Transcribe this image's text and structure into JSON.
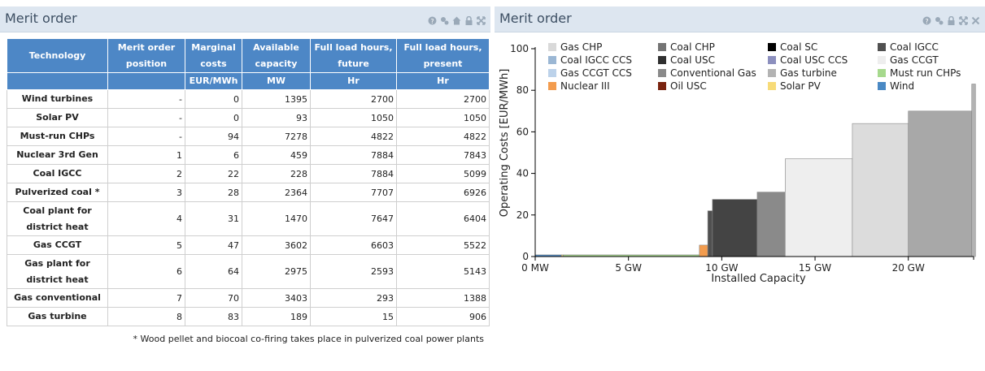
{
  "left_panel": {
    "title": "Merit order",
    "table": {
      "headers": [
        "Technology",
        "Merit order position",
        "Marginal costs",
        "Available capacity",
        "Full load hours, future",
        "Full load hours, present"
      ],
      "units": [
        "",
        "",
        "EUR/MWh",
        "MW",
        "Hr",
        "Hr"
      ],
      "rows": [
        {
          "technology": "Wind turbines",
          "position": "-",
          "marginal_costs": "0",
          "capacity": "1395",
          "flh_future": "2700",
          "flh_present": "2700"
        },
        {
          "technology": "Solar PV",
          "position": "-",
          "marginal_costs": "0",
          "capacity": "93",
          "flh_future": "1050",
          "flh_present": "1050"
        },
        {
          "technology": "Must-run CHPs",
          "position": "-",
          "marginal_costs": "94",
          "capacity": "7278",
          "flh_future": "4822",
          "flh_present": "4822"
        },
        {
          "technology": "Nuclear 3rd Gen",
          "position": "1",
          "marginal_costs": "6",
          "capacity": "459",
          "flh_future": "7884",
          "flh_present": "7843"
        },
        {
          "technology": "Coal IGCC",
          "position": "2",
          "marginal_costs": "22",
          "capacity": "228",
          "flh_future": "7884",
          "flh_present": "5099"
        },
        {
          "technology": "Pulverized coal *",
          "position": "3",
          "marginal_costs": "28",
          "capacity": "2364",
          "flh_future": "7707",
          "flh_present": "6926"
        },
        {
          "technology": "Coal plant for district heat",
          "position": "4",
          "marginal_costs": "31",
          "capacity": "1470",
          "flh_future": "7647",
          "flh_present": "6404"
        },
        {
          "technology": "Gas CCGT",
          "position": "5",
          "marginal_costs": "47",
          "capacity": "3602",
          "flh_future": "6603",
          "flh_present": "5522"
        },
        {
          "technology": "Gas plant for district heat",
          "position": "6",
          "marginal_costs": "64",
          "capacity": "2975",
          "flh_future": "2593",
          "flh_present": "5143"
        },
        {
          "technology": "Gas conventional",
          "position": "7",
          "marginal_costs": "70",
          "capacity": "3403",
          "flh_future": "293",
          "flh_present": "1388"
        },
        {
          "technology": "Gas turbine",
          "position": "8",
          "marginal_costs": "83",
          "capacity": "189",
          "flh_future": "15",
          "flh_present": "906"
        }
      ],
      "footnote": "* Wood pellet and biocoal co-firing takes place in pulverized coal power plants"
    }
  },
  "right_panel": {
    "title": "Merit order"
  },
  "chart_data": {
    "type": "bar",
    "xlabel": "Installed Capacity",
    "ylabel": "Operating Costs [EUR/MWh]",
    "xlim": [
      0,
      23.5
    ],
    "ylim": [
      0,
      100
    ],
    "x_ticks": [
      {
        "value": 0,
        "label": "0 MW"
      },
      {
        "value": 5,
        "label": "5 GW"
      },
      {
        "value": 10,
        "label": "10 GW"
      },
      {
        "value": 15,
        "label": "15 GW"
      },
      {
        "value": 20,
        "label": "20 GW"
      }
    ],
    "y_ticks": [
      0,
      20,
      40,
      60,
      80,
      100
    ],
    "legend": [
      {
        "name": "Gas CHP",
        "color": "#d9d9d9"
      },
      {
        "name": "Coal CHP",
        "color": "#747474"
      },
      {
        "name": "Coal SC",
        "color": "#000000"
      },
      {
        "name": "Coal IGCC",
        "color": "#505050"
      },
      {
        "name": "Coal IGCC CCS",
        "color": "#9bb7d4"
      },
      {
        "name": "Coal USC",
        "color": "#2f2f2f"
      },
      {
        "name": "Coal USC CCS",
        "color": "#8c8fbe"
      },
      {
        "name": "Gas CCGT",
        "color": "#eeeeee"
      },
      {
        "name": "Gas CCGT CCS",
        "color": "#bcd2ea"
      },
      {
        "name": "Conventional Gas",
        "color": "#8a8a8a"
      },
      {
        "name": "Gas turbine",
        "color": "#b3b3b3"
      },
      {
        "name": "Must run CHPs",
        "color": "#a6d98d"
      },
      {
        "name": "Nuclear III",
        "color": "#f39c4e"
      },
      {
        "name": "Oil USC",
        "color": "#7a2410"
      },
      {
        "name": "Solar PV",
        "color": "#f7db78"
      },
      {
        "name": "Wind",
        "color": "#4a89c4"
      }
    ],
    "legend_placement": "top",
    "blocks": [
      {
        "technology": "Wind",
        "x_start": 0,
        "x_end": 1.4,
        "y": 0.8,
        "color": "#4a89c4"
      },
      {
        "technology": "Solar PV",
        "x_start": 1.4,
        "x_end": 1.5,
        "y": 0.8,
        "color": "#f7db78"
      },
      {
        "technology": "Must run CHPs",
        "x_start": 1.5,
        "x_end": 8.8,
        "y": 0.8,
        "color": "#a6d98d"
      },
      {
        "technology": "Nuclear III",
        "x_start": 8.8,
        "x_end": 9.25,
        "y": 5.5,
        "color": "#f39c4e"
      },
      {
        "technology": "Coal IGCC",
        "x_start": 9.25,
        "x_end": 9.5,
        "y": 22,
        "color": "#505050"
      },
      {
        "technology": "Coal USC",
        "x_start": 9.5,
        "x_end": 11.9,
        "y": 27.5,
        "color": "#444444"
      },
      {
        "technology": "Coal CHP",
        "x_start": 11.9,
        "x_end": 13.4,
        "y": 31,
        "color": "#8a8a8a"
      },
      {
        "technology": "Gas CCGT",
        "x_start": 13.4,
        "x_end": 17.0,
        "y": 47,
        "color": "#eeeeee"
      },
      {
        "technology": "Gas CHP",
        "x_start": 17.0,
        "x_end": 20.0,
        "y": 64,
        "color": "#dcdcdc"
      },
      {
        "technology": "Conventional Gas",
        "x_start": 20.0,
        "x_end": 23.4,
        "y": 70,
        "color": "#a8a8a8"
      },
      {
        "technology": "Gas turbine",
        "x_start": 23.4,
        "x_end": 23.6,
        "y": 83,
        "color": "#b3b3b3"
      }
    ],
    "grid": false
  }
}
